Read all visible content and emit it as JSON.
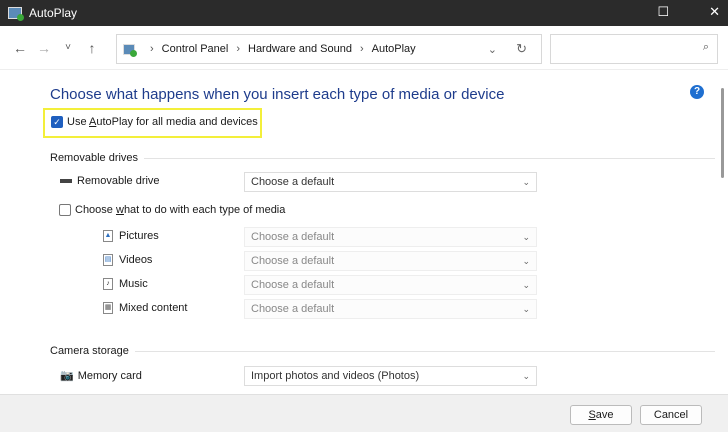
{
  "window": {
    "title": "AutoPlay",
    "close": "✕",
    "maximize": "☐"
  },
  "nav": {
    "back": "←",
    "forward": "→",
    "recent": "˅",
    "up": "↑"
  },
  "breadcrumb": [
    "Control Panel",
    "Hardware and Sound",
    "AutoPlay"
  ],
  "search": {
    "placeholder": "",
    "icon": "⌕"
  },
  "main": {
    "heading": "Choose what happens when you insert each type of media or device",
    "use_autoplay": {
      "label_pre": "Use ",
      "label_u": "A",
      "label_post": "utoPlay for all media and devices",
      "checked": true
    },
    "removable": {
      "group": "Removable drives",
      "drive_label": "Removable drive",
      "drive_value": "Choose a default",
      "per_media": {
        "label_pre": "Choose ",
        "label_u": "w",
        "label_post": "hat to do with each type of media",
        "checked": false
      },
      "media": [
        {
          "label": "Pictures",
          "value": "Choose a default"
        },
        {
          "label": "Videos",
          "value": "Choose a default"
        },
        {
          "label": "Music",
          "value": "Choose a default"
        },
        {
          "label": "Mixed content",
          "value": "Choose a default"
        }
      ]
    },
    "camera": {
      "group": "Camera storage",
      "card_label": "Memory card",
      "card_value": "Import photos and videos (Photos)"
    }
  },
  "footer": {
    "save": "Save",
    "cancel": "Cancel"
  }
}
